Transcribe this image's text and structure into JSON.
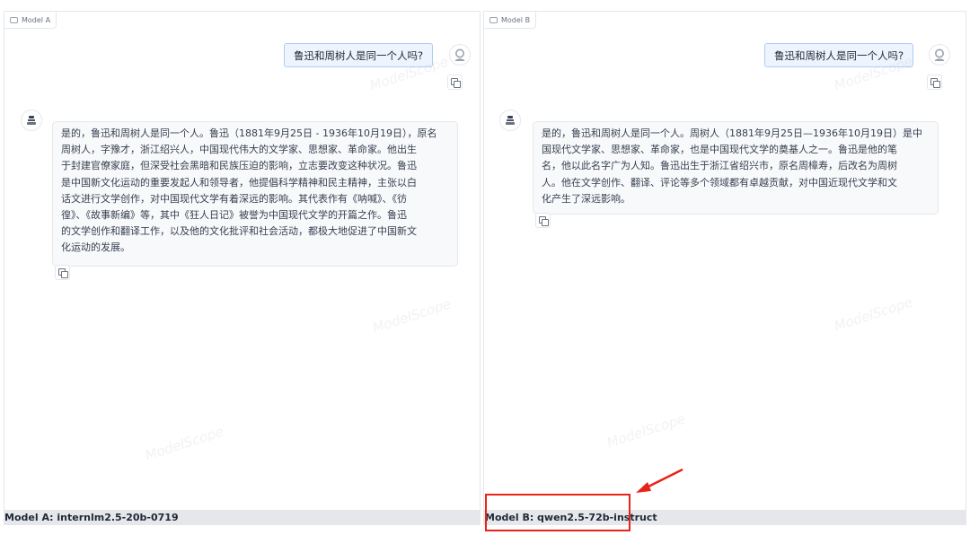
{
  "panels": [
    {
      "tab_label": "Model A",
      "user_message": "鲁迅和周树人是同一个人吗?",
      "bot_lines": [
        "是的，鲁迅和周树人是同一个人。鲁迅（1881年9月25日 - 1936年10月19日），原名",
        "周树人，字豫才，浙江绍兴人，中国现代伟大的文学家、思想家、革命家。他出生",
        "于封建官僚家庭，但深受社会黑暗和民族压迫的影响，立志要改变这种状况。鲁迅",
        "是中国新文化运动的重要发起人和领导者，他提倡科学精神和民主精神，主张以白",
        "话文进行文学创作，对中国现代文学有着深远的影响。其代表作有《呐喊》、《彷",
        "徨》、《故事新编》等，其中《狂人日记》被誉为中国现代文学的开篇之作。鲁迅",
        "的文学创作和翻译工作，以及他的文化批评和社会活动，都极大地促进了中国新文",
        "化运动的发展。"
      ],
      "footer": "Model A: internlm2.5-20b-0719"
    },
    {
      "tab_label": "Model B",
      "user_message": "鲁迅和周树人是同一个人吗?",
      "bot_lines": [
        "是的，鲁迅和周树人是同一个人。周树人（1881年9月25日—1936年10月19日）是中",
        "国现代文学家、思想家、革命家，也是中国现代文学的奠基人之一。鲁迅是他的笔",
        "名，他以此名字广为人知。鲁迅出生于浙江省绍兴市，原名周樟寿，后改名为周树",
        "人。他在文学创作、翻译、评论等多个领域都有卓越贡献，对中国近现代文学和文",
        "化产生了深远影响。"
      ],
      "footer": "Model B: qwen2.5-72b-instruct"
    }
  ],
  "watermark": "ModelScope",
  "colors": {
    "user_bubble_bg": "#eef4fe",
    "user_bubble_border": "#aecbf5",
    "bot_bubble_bg": "#f8f9fb",
    "footer_bg": "#e5e7eb",
    "annotation_red": "#e8231a"
  },
  "icons": {
    "tab": "chat-icon",
    "user_avatar": "user-avatar-icon",
    "bot_avatar": "bot-avatar-icon",
    "copy": "copy-icon",
    "annotation": "red-arrow"
  }
}
